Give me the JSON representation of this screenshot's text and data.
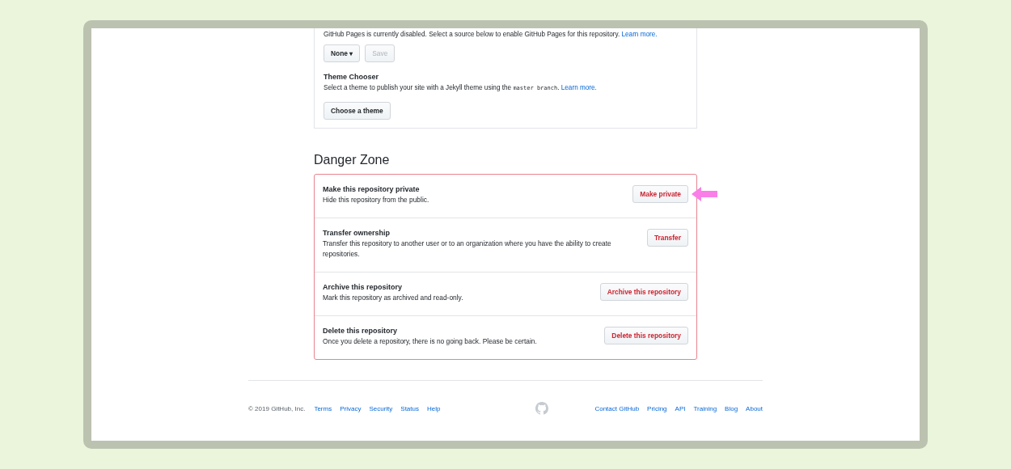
{
  "pages": {
    "status_text": "GitHub Pages is currently disabled. Select a source below to enable GitHub Pages for this repository.",
    "status_link": "Learn more.",
    "source_dropdown": "None ▾",
    "save_button": {
      "label": "Save",
      "disabled": true
    },
    "theme_title": "Theme Chooser",
    "theme_text_before": "Select a theme to publish your site with a Jekyll theme using the",
    "theme_branch": "master branch",
    "theme_text_after": ".",
    "theme_link": "Learn more.",
    "theme_button": "Choose a theme"
  },
  "danger_zone": {
    "heading": "Danger Zone",
    "rows": [
      {
        "title": "Make this repository private",
        "description": "Hide this repository from the public.",
        "button": "Make private",
        "annotated": true
      },
      {
        "title": "Transfer ownership",
        "description": "Transfer this repository to another user or to an organization where you have the ability to create repositories.",
        "button": "Transfer",
        "annotated": false
      },
      {
        "title": "Archive this repository",
        "description": "Mark this repository as archived and read-only.",
        "button": "Archive this repository",
        "annotated": false
      },
      {
        "title": "Delete this repository",
        "description": "Once you delete a repository, there is no going back. Please be certain.",
        "button": "Delete this repository",
        "annotated": false
      }
    ]
  },
  "footer": {
    "copyright": "© 2019 GitHub, Inc.",
    "left_links": [
      "Terms",
      "Privacy",
      "Security",
      "Status",
      "Help"
    ],
    "right_links": [
      "Contact GitHub",
      "Pricing",
      "API",
      "Training",
      "Blog",
      "About"
    ]
  }
}
